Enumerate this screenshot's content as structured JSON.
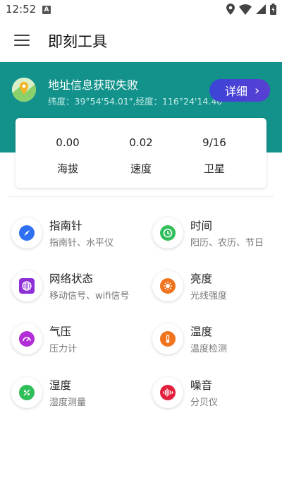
{
  "status_bar": {
    "time": "12:52",
    "notification_icon": "a-letter-icon",
    "icons": [
      "location-icon",
      "wifi-icon",
      "signal-icon",
      "battery-icon"
    ]
  },
  "app_bar": {
    "title": "即刻工具",
    "menu_icon": "hamburger-menu-icon"
  },
  "location": {
    "title": "地址信息获取失败",
    "coords": "纬度：39°54'54.01\",经度：116°24'14.40\"",
    "detail_label": "详细",
    "detail_chevron": "›"
  },
  "stats": [
    {
      "value": "0.00",
      "label": "海拔"
    },
    {
      "value": "0.02",
      "label": "速度"
    },
    {
      "value": "9/16",
      "label": "卫星"
    }
  ],
  "tools": [
    {
      "name": "指南针",
      "desc": "指南针、水平仪",
      "icon": "compass-icon",
      "color": "#2f6ff2"
    },
    {
      "name": "时间",
      "desc": "阳历、农历、节日",
      "icon": "clock-icon",
      "color": "#2fbe59"
    },
    {
      "name": "网络状态",
      "desc": "移动信号、wifi信号",
      "icon": "globe-icon",
      "color": "#8e2fd6"
    },
    {
      "name": "亮度",
      "desc": "光线强度",
      "icon": "brightness-icon",
      "color": "#f0741e"
    },
    {
      "name": "气压",
      "desc": "压力计",
      "icon": "gauge-icon",
      "color": "#b12ed6"
    },
    {
      "name": "温度",
      "desc": "温度检测",
      "icon": "thermometer-icon",
      "color": "#f0741e"
    },
    {
      "name": "湿度",
      "desc": "湿度测量",
      "icon": "humidity-icon",
      "color": "#2fbe59"
    },
    {
      "name": "噪音",
      "desc": "分贝仪",
      "icon": "soundwave-icon",
      "color": "#e3203c"
    }
  ],
  "colors": {
    "banner": "#12928b",
    "detail_button": "#3a44d6"
  }
}
